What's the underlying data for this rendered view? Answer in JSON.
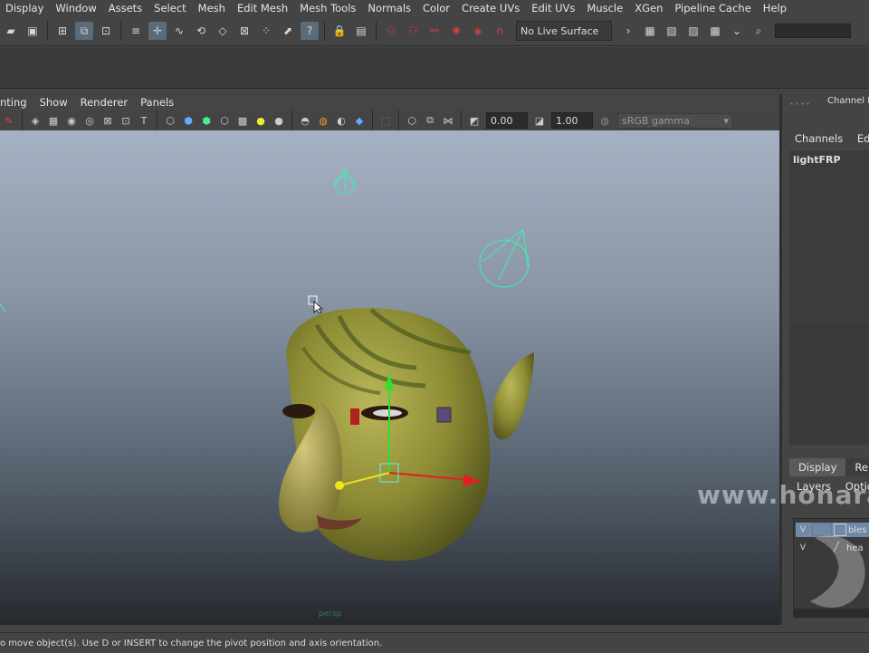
{
  "menubar": [
    "Display",
    "Window",
    "Assets",
    "Select",
    "Mesh",
    "Edit Mesh",
    "Mesh Tools",
    "Normals",
    "Color",
    "Create UVs",
    "Edit UVs",
    "Muscle",
    "XGen",
    "Pipeline Cache",
    "Help"
  ],
  "toolbar": {
    "live_surface": "No Live Surface"
  },
  "viewport_menu": [
    "nting",
    "Show",
    "Renderer",
    "Panels"
  ],
  "viewport_toolbar": {
    "exposure": "0.00",
    "gamma": "1.00",
    "colorspace": "sRGB gamma"
  },
  "viewport": {
    "camera": "persp"
  },
  "channel_box": {
    "title": "Channel Box",
    "menu": [
      "Channels",
      "Edit"
    ],
    "selected_object": "lightFRP"
  },
  "layers": {
    "tabs": [
      "Display",
      "Render"
    ],
    "menu": [
      "Layers",
      "Options"
    ],
    "rows": [
      {
        "visible": "V",
        "name": "bles"
      },
      {
        "visible": "V",
        "name": "hea"
      }
    ]
  },
  "help_line": "o move object(s). Use D or INSERT to change the pivot position and axis orientation.",
  "watermark": "www.honara",
  "colors": {
    "accent_selected": "#6f8aa8",
    "light_gizmo": "#3ef0b0"
  }
}
